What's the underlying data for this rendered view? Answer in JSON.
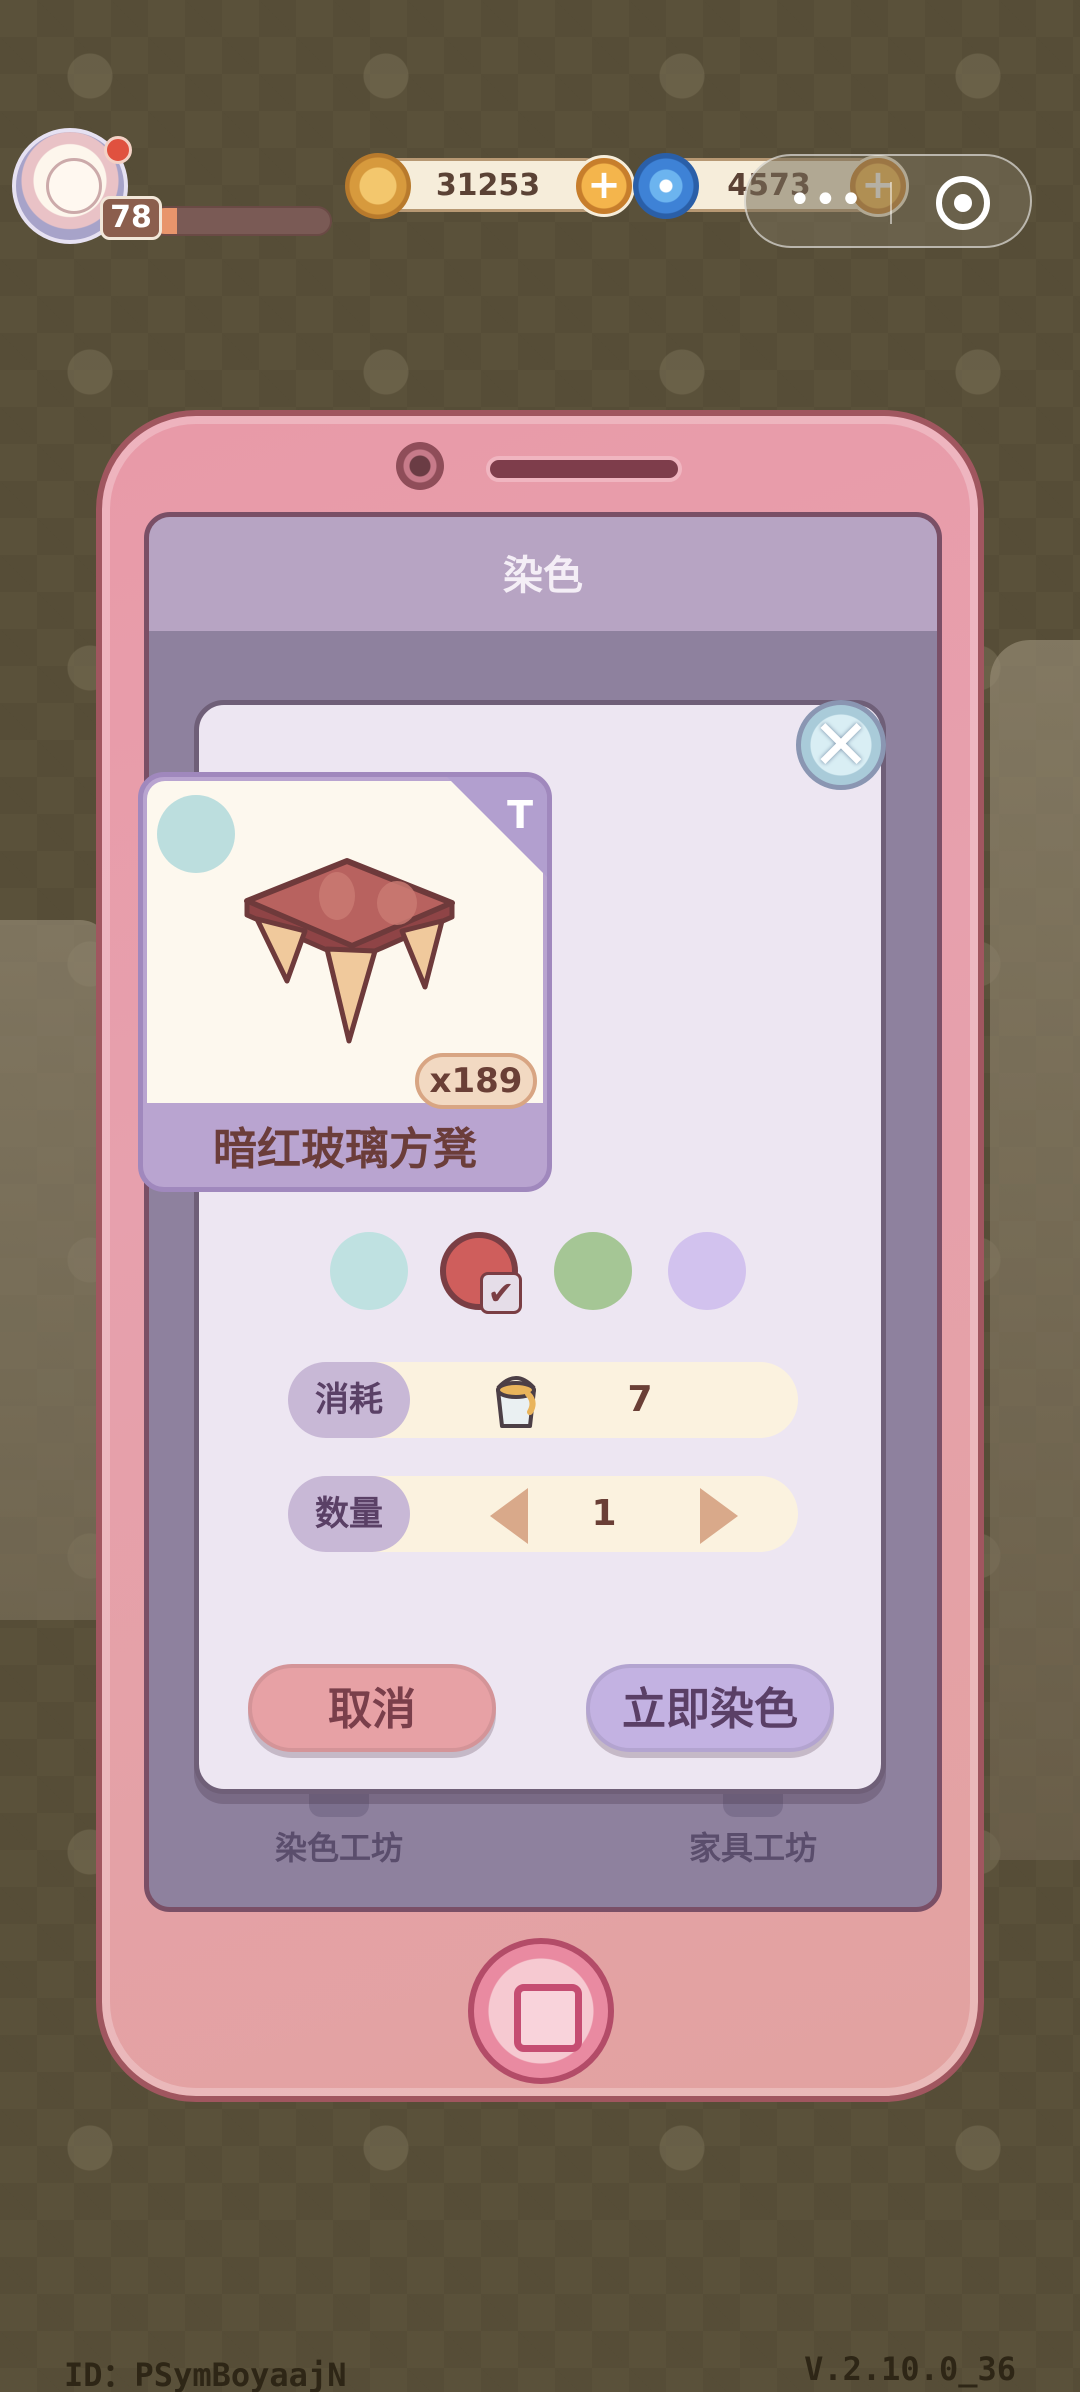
{
  "player": {
    "level": "78",
    "xp_progress": 0.14
  },
  "currencies": [
    {
      "icon": "coin-icon",
      "value": "31253",
      "add": "+"
    },
    {
      "icon": "swirl-gem-icon",
      "value": "4573",
      "add": "+"
    }
  ],
  "mini_program": {
    "more": "•••",
    "close_icon": "target-icon"
  },
  "screen": {
    "title": "染色",
    "tabs": [
      {
        "label": "染色工坊",
        "icon": "paint-roller-icon"
      },
      {
        "label": "家具工坊",
        "icon": "wrench-icon"
      }
    ]
  },
  "dialog": {
    "close": "✕",
    "item": {
      "name": "暗红玻璃方凳",
      "quantity": "x189",
      "corner_icon": "T"
    },
    "swatches": [
      {
        "color": "#bfe1e1",
        "selected": false
      },
      {
        "color": "#cf5e5c",
        "selected": true,
        "check": "✔"
      },
      {
        "color": "#a5c695",
        "selected": false
      },
      {
        "color": "#d2c2ee",
        "selected": false
      }
    ],
    "cost": {
      "label": "消耗",
      "value": "7",
      "icon": "paint-bucket-icon"
    },
    "amount": {
      "label": "数量",
      "value": "1"
    },
    "cancel_label": "取消",
    "confirm_label": "立即染色"
  },
  "footer": {
    "id": "ID：PSymBoyaajN",
    "version": "V.2.10.0_36"
  },
  "colors": {
    "phone_pink": "#e89aa8",
    "dialog_bg": "#ede6f2",
    "accent_red": "#cf5e5c"
  }
}
